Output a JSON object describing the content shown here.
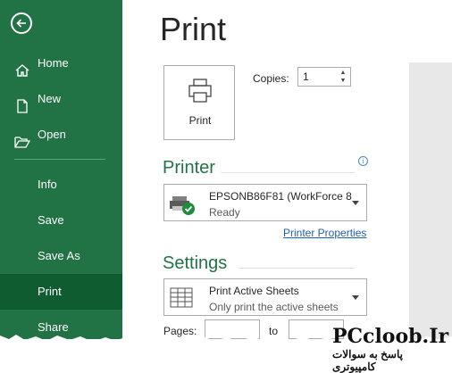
{
  "sidebar": {
    "items": [
      {
        "label": "Home",
        "icon": "home-icon"
      },
      {
        "label": "New",
        "icon": "new-file-icon"
      },
      {
        "label": "Open",
        "icon": "folder-open-icon"
      },
      {
        "label": "Info"
      },
      {
        "label": "Save"
      },
      {
        "label": "Save As"
      },
      {
        "label": "Print",
        "active": true
      },
      {
        "label": "Share"
      }
    ],
    "accent": "#217346",
    "active_bg": "#0e5c2f"
  },
  "main": {
    "title": "Print",
    "print_button_label": "Print",
    "copies_label": "Copies:",
    "copies_value": "1"
  },
  "printer": {
    "heading": "Printer",
    "name": "EPSONB86F81 (WorkForce 8...",
    "status": "Ready",
    "properties_link": "Printer Properties"
  },
  "settings": {
    "heading": "Settings",
    "sheets_title": "Print Active Sheets",
    "sheets_desc": "Only print the active sheets",
    "pages_label": "Pages:",
    "to_label": "to"
  },
  "watermark": {
    "title": "PCcloob.Ir",
    "subtitle": "پاسخ به سوالات کامپیوتری"
  }
}
